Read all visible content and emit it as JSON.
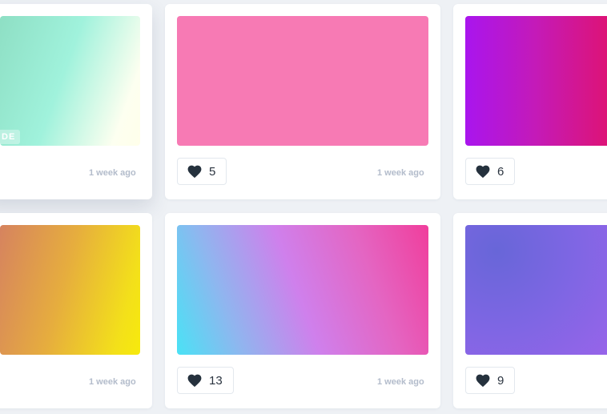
{
  "cards": [
    {
      "badge": "DE",
      "time": "1 week ago",
      "likes": null
    },
    {
      "badge": null,
      "time": "1 week ago",
      "likes": "5"
    },
    {
      "badge": null,
      "time": null,
      "likes": "6"
    },
    {
      "badge": null,
      "time": "1 week ago",
      "likes": null
    },
    {
      "badge": null,
      "time": "1 week ago",
      "likes": "13"
    },
    {
      "badge": null,
      "time": null,
      "likes": "9"
    }
  ],
  "icons": {
    "like": "heart-icon"
  },
  "colors": {
    "background": "#eef1f5",
    "text_muted": "#b3bccb",
    "heart": "#25313d"
  }
}
